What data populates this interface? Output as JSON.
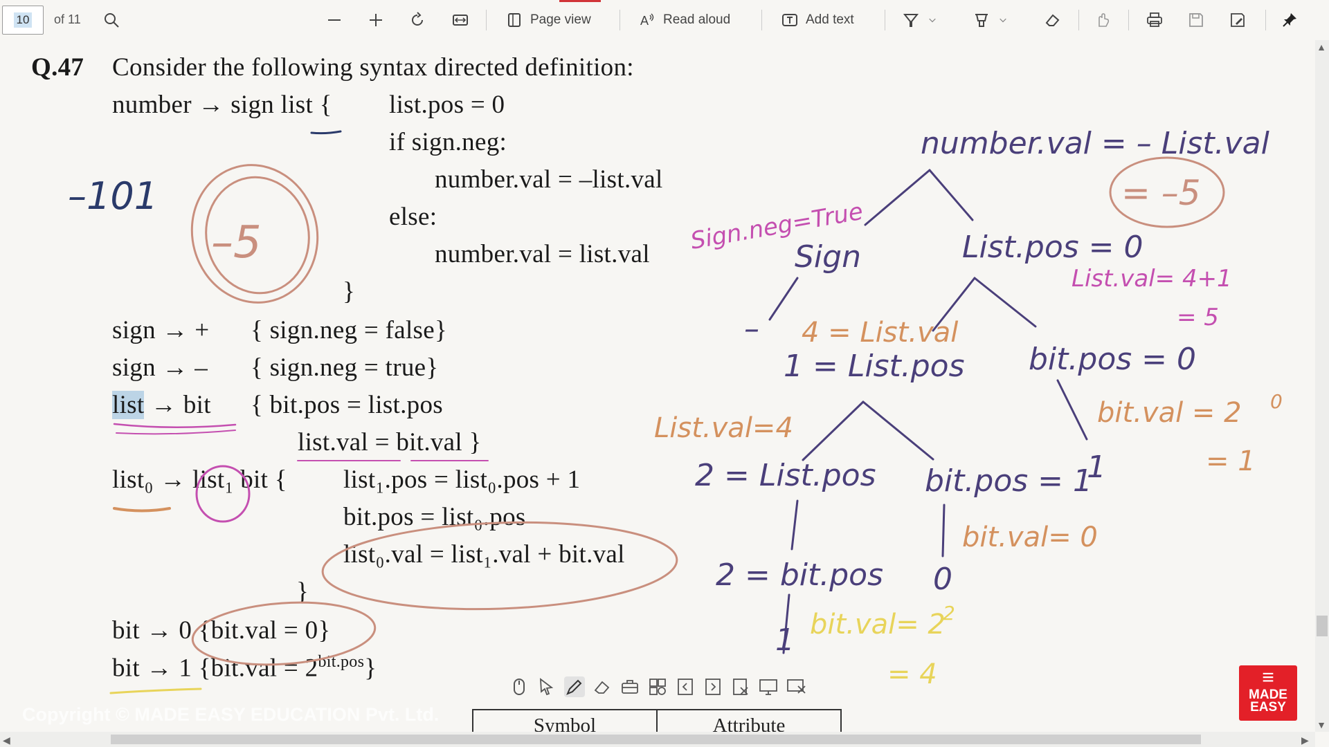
{
  "toolbar": {
    "page_number": "10",
    "page_count": "of 11",
    "page_view_label": "Page view",
    "read_aloud_label": "Read aloud",
    "add_text_label": "Add text"
  },
  "document": {
    "question_number": "Q.47",
    "question_text": "Consider the following syntax directed definition:",
    "rule1_head": "number → sign list {",
    "rule1_line1": "list.pos = 0",
    "rule1_line2": "if sign.neg:",
    "rule1_line3": "number.val = –list.val",
    "rule1_line4": "else:",
    "rule1_line5": "number.val = list.val",
    "rule1_close": "}",
    "rule2_head": "sign → +",
    "rule2_body": "{    sign.neg = false}",
    "rule3_head": "sign → –",
    "rule3_body": "{    sign.neg = true}",
    "rule4_list": "list",
    "rule4_head_rest": " → bit",
    "rule4_body1": "{    bit.pos = list.pos",
    "rule4_body2": "list.val = bit.val  }",
    "rule5_head": "list₀ → list₁ bit {",
    "rule5_line1": "list₁.pos = list₀.pos + 1",
    "rule5_line2": "bit.pos = list₀.pos",
    "rule5_line3": "list₀.val = list₁.val + bit.val",
    "rule5_close": "}",
    "rule6": "bit → 0 {bit.val = 0}",
    "rule7_main": "bit → 1 {bit.val = 2",
    "rule7_sup": "bit.pos",
    "rule7_close": "}"
  },
  "handwriting": {
    "input": "–101",
    "result_circle": "–5",
    "number_val": "number.val = – List.val",
    "number_val_eq": "= –5",
    "sign_neg": "Sign.neg=True",
    "sign": "Sign",
    "minus": "–",
    "list_pos_0": "List.pos = 0",
    "list_val_1": "List.val= 4+1",
    "list_val_1b": "= 5",
    "list_val_4": "4 = List.val",
    "list_pos_1": "1 = List.pos",
    "bit_pos_0": "bit.pos = 0",
    "bit_val_a": "bit.val = 2",
    "bit_val_a_exp": "0",
    "bit_val_a2": "= 1",
    "list_val_2": "List.val=4",
    "list_pos_2": "2 = List.pos",
    "bit_pos_1": "bit.pos = 1",
    "bit_val_b": "bit.val= 0",
    "bit_pos_2": "2 = bit.pos",
    "digit_0": "0",
    "digit_1a": "1",
    "digit_1b": "1",
    "bit_val_c": "bit.val= 2",
    "bit_val_c_exp": "2",
    "bit_val_c2": "= 4"
  },
  "table": {
    "col1": "Symbol",
    "col2": "Attribute"
  },
  "watermark": "Copyright © MADE EASY EDUCATION Pvt. Ltd.",
  "logo": {
    "line1": "MADE",
    "line2": "EASY"
  },
  "colors": {
    "tree_ink": "#4a3f7a",
    "orange_ink": "#d4915e",
    "pink_ink": "#c44fb0",
    "yellow_ink": "#e8d45a",
    "circle_ink": "#c98f7e",
    "brand_red": "#e32028"
  }
}
